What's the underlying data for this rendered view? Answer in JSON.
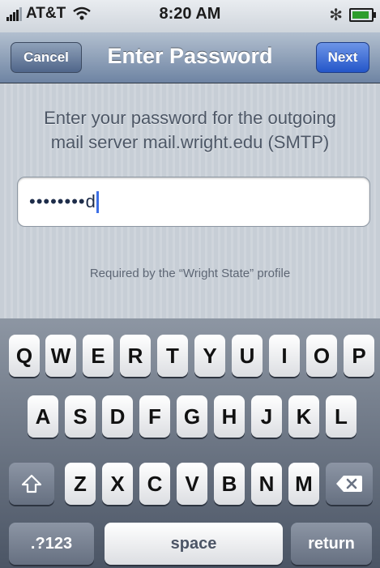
{
  "status_bar": {
    "carrier": "AT&T",
    "time": "8:20 AM",
    "signal_bars": 4,
    "battery_level": 0.9
  },
  "nav": {
    "title": "Enter Password",
    "cancel_label": "Cancel",
    "next_label": "Next"
  },
  "content": {
    "prompt_line1": "Enter your password for the outgoing",
    "prompt_line2": "mail server mail.wright.edu (SMTP)",
    "password_masked": "••••••••",
    "password_last_char": "d",
    "footnote": "Required by the “Wright State” profile"
  },
  "keyboard": {
    "row1": [
      "Q",
      "W",
      "E",
      "R",
      "T",
      "Y",
      "U",
      "I",
      "O",
      "P"
    ],
    "row2": [
      "A",
      "S",
      "D",
      "F",
      "G",
      "H",
      "J",
      "K",
      "L"
    ],
    "row3": [
      "Z",
      "X",
      "C",
      "V",
      "B",
      "N",
      "M"
    ],
    "numbers_label": ".?123",
    "space_label": "space",
    "return_label": "return"
  },
  "colors": {
    "nav_bar": "#6e84a3",
    "next_button": "#2456c9",
    "caret": "#3d6fe6"
  },
  "icons": {
    "wifi": "wifi-icon",
    "bluetooth": "bluetooth-icon",
    "battery": "battery-icon",
    "shift": "shift-icon",
    "delete": "delete-icon"
  }
}
